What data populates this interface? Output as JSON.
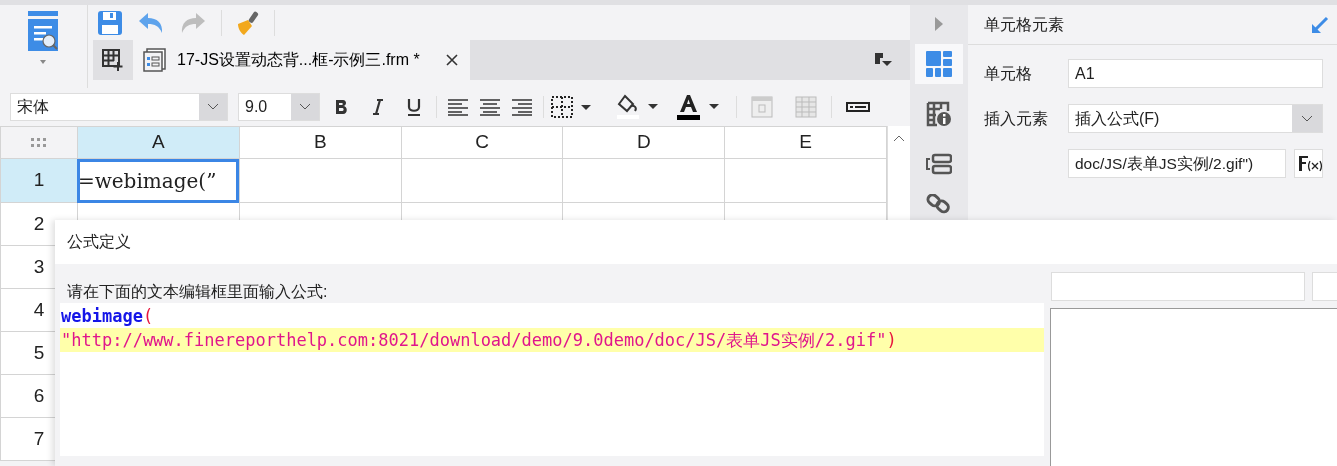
{
  "tabs": [
    {
      "label": "17-JS设置动态背...框-示例三.frm *",
      "selected": true
    }
  ],
  "format": {
    "font": "宋体",
    "size": "9.0"
  },
  "sheet": {
    "columns": [
      {
        "label": "A",
        "selected": true
      },
      {
        "label": "B",
        "selected": false
      },
      {
        "label": "C",
        "selected": false
      },
      {
        "label": "D",
        "selected": false
      },
      {
        "label": "E",
        "selected": false
      }
    ],
    "rows": [
      {
        "label": "1",
        "selected": true,
        "cells": [
          "=webimage(”",
          "",
          "",
          "",
          ""
        ]
      },
      {
        "label": "2",
        "selected": false,
        "cells": [
          "",
          "",
          "",
          "",
          ""
        ]
      },
      {
        "label": "3",
        "selected": false,
        "cells": [
          "",
          "",
          "",
          "",
          ""
        ]
      },
      {
        "label": "4",
        "selected": false,
        "cells": [
          "",
          "",
          "",
          "",
          ""
        ]
      },
      {
        "label": "5",
        "selected": false,
        "cells": [
          "",
          "",
          "",
          "",
          ""
        ]
      },
      {
        "label": "6",
        "selected": false,
        "cells": [
          "",
          "",
          "",
          "",
          ""
        ]
      },
      {
        "label": "7",
        "selected": false,
        "cells": [
          "",
          "",
          "",
          "",
          ""
        ]
      }
    ]
  },
  "side_tabs": [
    {
      "kind": "cell",
      "selected": true
    },
    {
      "kind": "attr",
      "selected": false
    },
    {
      "kind": "widget",
      "selected": false
    },
    {
      "kind": "link",
      "selected": false
    }
  ],
  "panel": {
    "title": "单元格元素",
    "cell_label": "单元格",
    "cell_value": "A1",
    "insert_label": "插入元素",
    "insert_value": "插入公式(F)",
    "formula_value": "doc/JS/表单JS实例/2.gif\")"
  },
  "dialog": {
    "title": "公式定义",
    "prompt": "请在下面的文本编辑框里面输入公式:",
    "lines": [
      {
        "highlighted": false,
        "tokens": [
          {
            "kind": "fn",
            "text": "webimage"
          },
          {
            "kind": "paren",
            "text": "("
          }
        ]
      },
      {
        "highlighted": true,
        "tokens": [
          {
            "kind": "string",
            "text": "\"http://www.finereporthelp.com:8021/download/demo/9.0demo/doc/JS/表单JS实例/2.gif\""
          },
          {
            "kind": "paren",
            "text": ")"
          }
        ]
      }
    ]
  }
}
